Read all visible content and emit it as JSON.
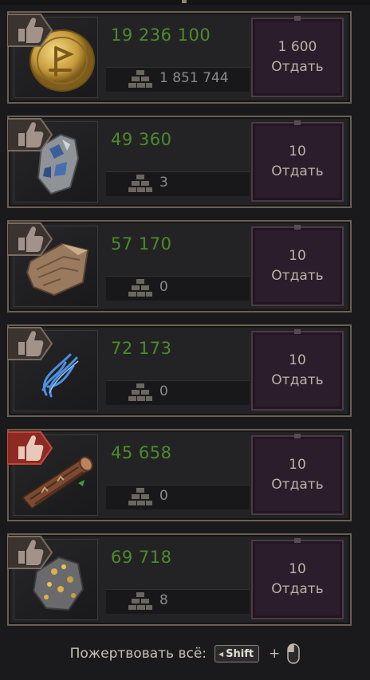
{
  "rows": [
    {
      "amount": "19 236 100",
      "stock": "1 851 744",
      "donate_count": "1 600",
      "donate_label": "Отдать",
      "icon": "gold-coin-icon",
      "active": false
    },
    {
      "amount": "49 360",
      "stock": "3",
      "donate_count": "10",
      "donate_label": "Отдать",
      "icon": "silver-ore-icon",
      "active": false
    },
    {
      "amount": "57 170",
      "stock": "0",
      "donate_count": "10",
      "donate_label": "Отдать",
      "icon": "leather-hide-icon",
      "active": false
    },
    {
      "amount": "72 173",
      "stock": "0",
      "donate_count": "10",
      "donate_label": "Отдать",
      "icon": "blue-thread-icon",
      "active": false
    },
    {
      "amount": "45 658",
      "stock": "0",
      "donate_count": "10",
      "donate_label": "Отдать",
      "icon": "wood-log-icon",
      "active": true
    },
    {
      "amount": "69 718",
      "stock": "8",
      "donate_count": "10",
      "donate_label": "Отдать",
      "icon": "gold-ore-icon",
      "active": false
    }
  ],
  "footer": {
    "label": "Пожертвовать всё:",
    "key": "Shift",
    "plus": "+"
  },
  "colors": {
    "amount": "#4d8a2c",
    "donate_bg": "#2b1d2c",
    "thumb_active": "#8e2a24",
    "thumb_idle": "#6f625a"
  }
}
